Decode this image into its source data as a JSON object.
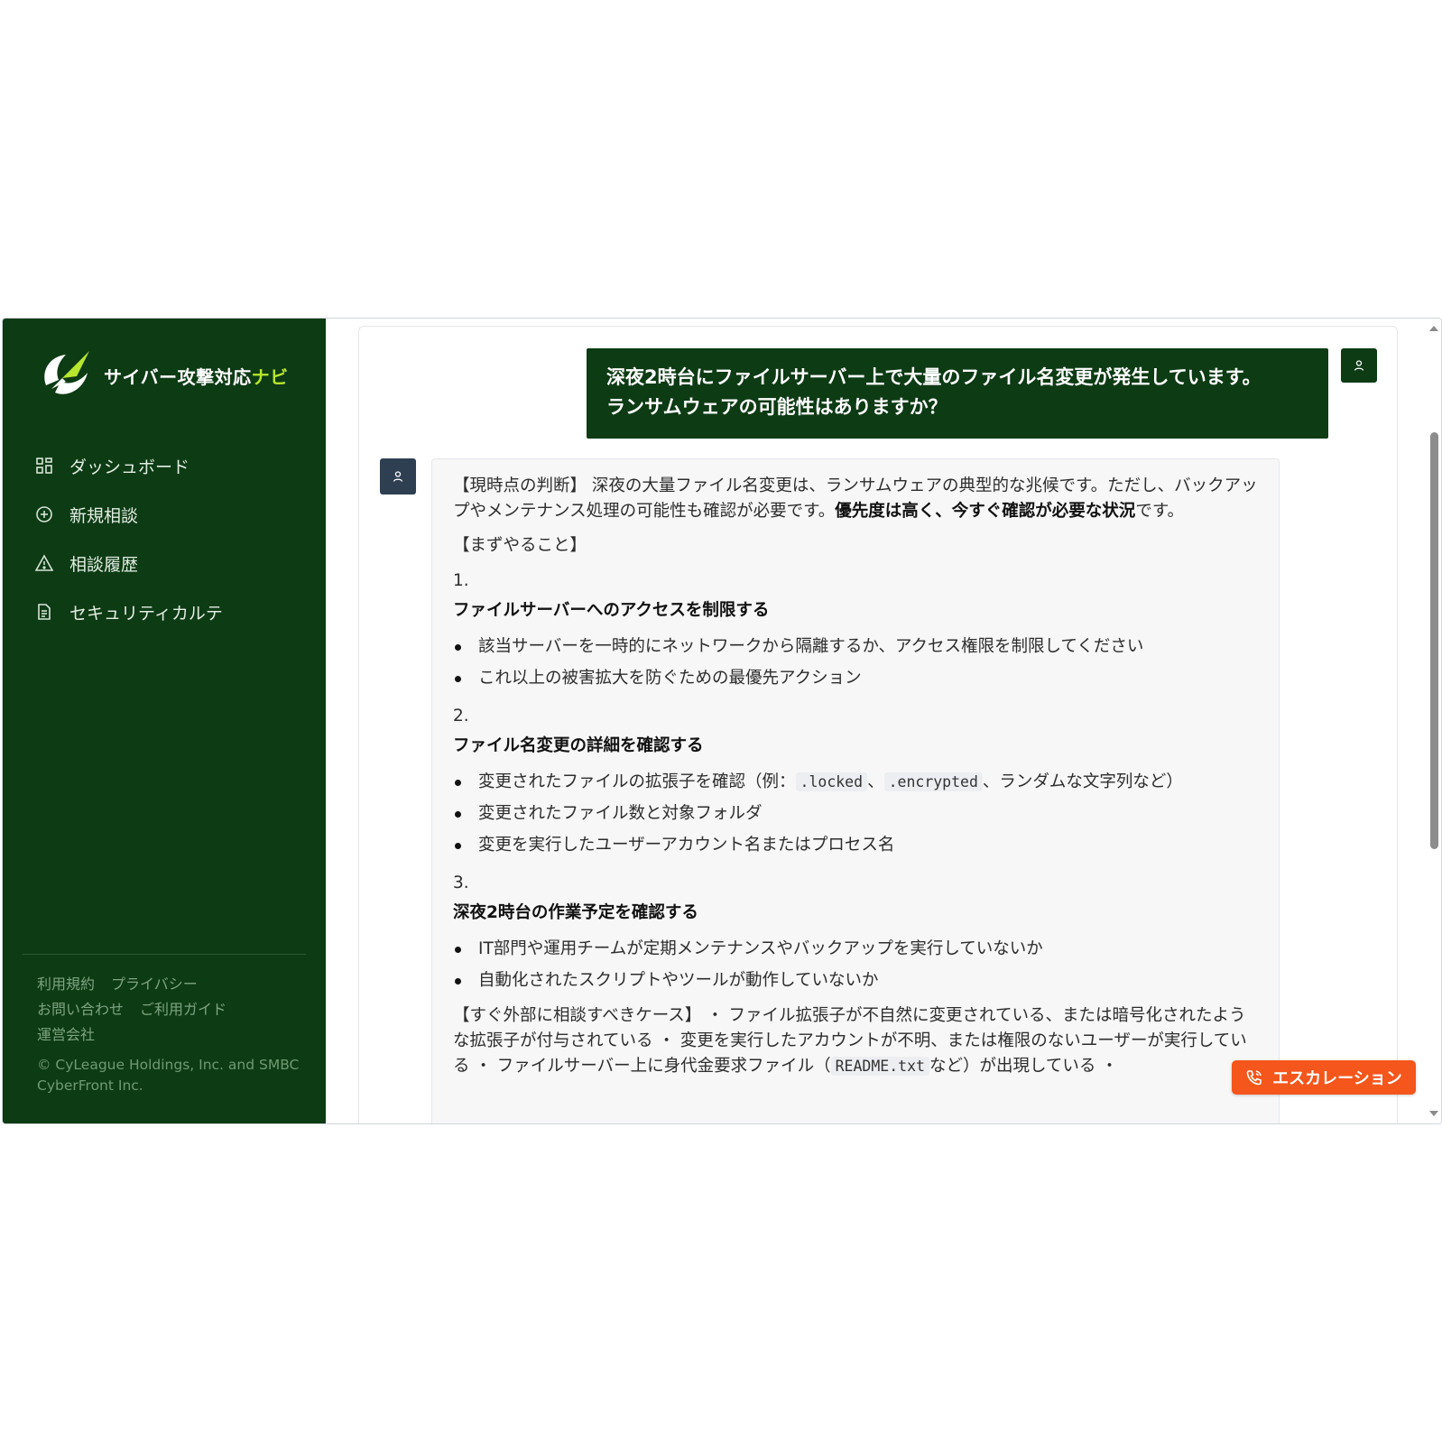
{
  "app": {
    "brand_main": "サイバー攻撃対応",
    "brand_accent": "ナビ",
    "accent_color": "#b8e62e",
    "sidebar_color": "#0d3b14",
    "escalation_color": "#f5561b"
  },
  "sidebar": {
    "items": [
      {
        "label": "ダッシュボード",
        "icon": "grid-icon"
      },
      {
        "label": "新規相談",
        "icon": "plus-circle-icon"
      },
      {
        "label": "相談履歴",
        "icon": "warning-triangle-icon"
      },
      {
        "label": "セキュリティカルテ",
        "icon": "document-icon"
      }
    ],
    "footer": {
      "terms": "利用規約",
      "privacy": "プライバシー",
      "contact": "お問い合わせ",
      "guide": "ご利用ガイド",
      "company": "運営会社",
      "copyright": "© CyLeague Holdings, Inc. and SMBC CyberFront Inc."
    }
  },
  "chat": {
    "user_message_line1": "深夜2時台にファイルサーバー上で大量のファイル名変更が発生しています。",
    "user_message_line2": "ランサムウェアの可能性はありますか？",
    "bot": {
      "judgement_prefix": "【現時点の判断】 深夜の大量ファイル名変更は、ランサムウェアの典型的な兆候です。ただし、バックアップやメンテナンス処理の可能性も確認が必要です。",
      "judgement_bold": "優先度は高く、今すぐ確認が必要な状況",
      "judgement_suffix": "です。",
      "todo_heading": "【まずやること】",
      "steps": [
        {
          "num": "1.",
          "title": "ファイルサーバーへのアクセスを制限する",
          "bullets": [
            "該当サーバーを一時的にネットワークから隔離するか、アクセス権限を制限してください",
            "これ以上の被害拡大を防ぐための最優先アクション"
          ]
        },
        {
          "num": "2.",
          "title": "ファイル名変更の詳細を確認する",
          "bullet1_prefix": "変更されたファイルの拡張子を確認（例：",
          "code1": ".locked",
          "sep": "、",
          "code2": ".encrypted",
          "bullet1_suffix": "、ランダムな文字列など）",
          "bullets": [
            "変更されたファイル数と対象フォルダ",
            "変更を実行したユーザーアカウント名またはプロセス名"
          ]
        },
        {
          "num": "3.",
          "title": "深夜2時台の作業予定を確認する",
          "bullets": [
            "IT部門や運用チームが定期メンテナンスやバックアップを実行していないか",
            "自動化されたスクリプトやツールが動作していないか"
          ]
        }
      ],
      "external_prefix": "【すぐ外部に相談すべきケース】 ・ ファイル拡張子が不自然に変更されている、または暗号化されたような拡張子が付与されている ・ 変更を実行したアカウントが不明、または権限のないユーザーが実行している ・ ファイルサーバー上に身代金要求ファイル（",
      "external_code": "README.txt",
      "external_suffix": "など）が出現している ・"
    }
  },
  "escalation": {
    "label": "エスカレーション",
    "icon": "phone-icon"
  }
}
